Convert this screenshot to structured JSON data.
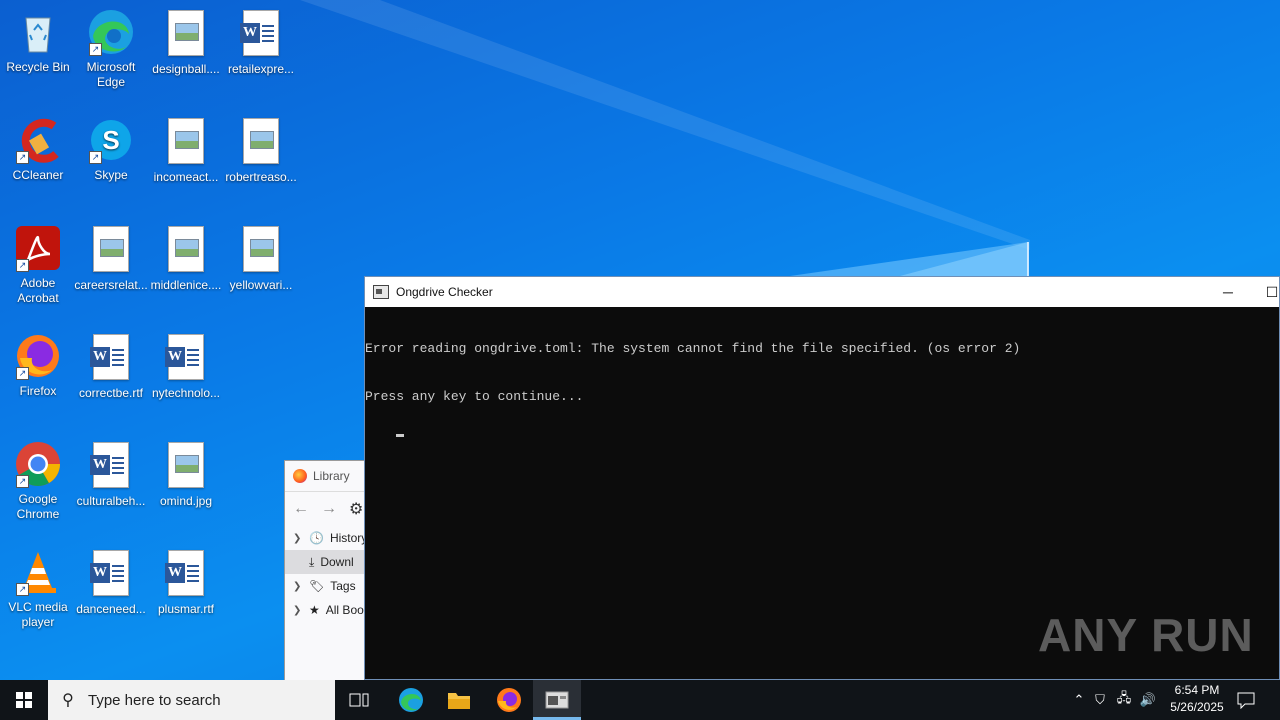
{
  "desktop": {
    "icons": [
      {
        "label": "Recycle Bin"
      },
      {
        "label": "Microsoft Edge"
      },
      {
        "label": "designball...."
      },
      {
        "label": "retailexpre..."
      },
      {
        "label": "CCleaner"
      },
      {
        "label": "Skype"
      },
      {
        "label": "incomeact..."
      },
      {
        "label": "robertreaso..."
      },
      {
        "label": "Adobe Acrobat"
      },
      {
        "label": "careersrelat..."
      },
      {
        "label": "middlenice...."
      },
      {
        "label": "yellowvari..."
      },
      {
        "label": "Firefox"
      },
      {
        "label": "correctbe.rtf"
      },
      {
        "label": "nytechnolo..."
      },
      {
        "label": "Google Chrome"
      },
      {
        "label": "culturalbeh..."
      },
      {
        "label": "omind.jpg"
      },
      {
        "label": "VLC media player"
      },
      {
        "label": "danceneed..."
      },
      {
        "label": "plusmar.rtf"
      }
    ]
  },
  "library": {
    "title": "Library",
    "items": [
      {
        "label": "History"
      },
      {
        "label": "Downl"
      },
      {
        "label": "Tags"
      },
      {
        "label": "All Boo"
      }
    ]
  },
  "console": {
    "title": "Ongdrive Checker",
    "line1": "Error reading ongdrive.toml: The system cannot find the file specified. (os error 2)",
    "line2": "Press any key to continue..."
  },
  "watermark": "ANY RUN",
  "taskbar": {
    "search_placeholder": "Type here to search",
    "time": "6:54 PM",
    "date": "5/26/2025"
  }
}
